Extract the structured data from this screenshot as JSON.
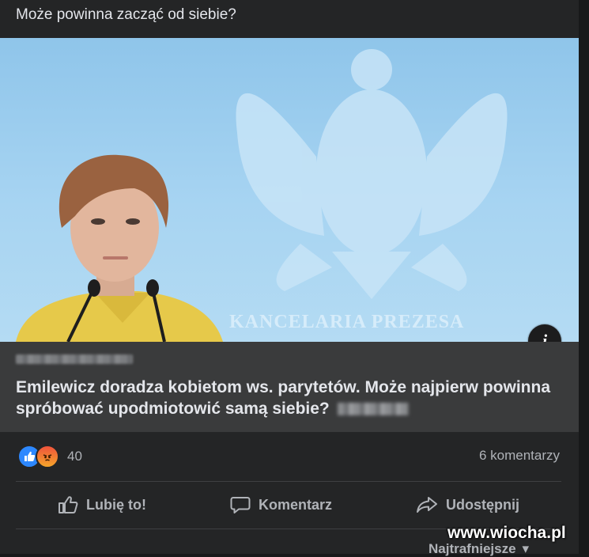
{
  "post": {
    "text": "Może powinna zacząć od siebie?"
  },
  "preview": {
    "watermark_text": "KANCELARIA PREZESA",
    "info_icon": "info-icon",
    "info_glyph": "i"
  },
  "link": {
    "headline": "Emilewicz doradza kobietom ws. parytetów. Może najpierw powinna spróbować upodmiotowić samą siebie?"
  },
  "reactions": {
    "count": "40",
    "icons": [
      "like-reaction-icon",
      "angry-reaction-icon"
    ]
  },
  "comments": {
    "count_label": "6 komentarzy"
  },
  "actions": {
    "like_label": "Lubię to!",
    "comment_label": "Komentarz",
    "share_label": "Udostępnij"
  },
  "sort": {
    "label": "Najtrafniejsze"
  },
  "site_watermark": "www.wiocha.pl",
  "colors": {
    "background": "#242526",
    "link_box": "#3a3b3c",
    "text_primary": "#e4e6eb",
    "text_secondary": "#b0b3b8",
    "like_blue": "#2d88ff"
  }
}
